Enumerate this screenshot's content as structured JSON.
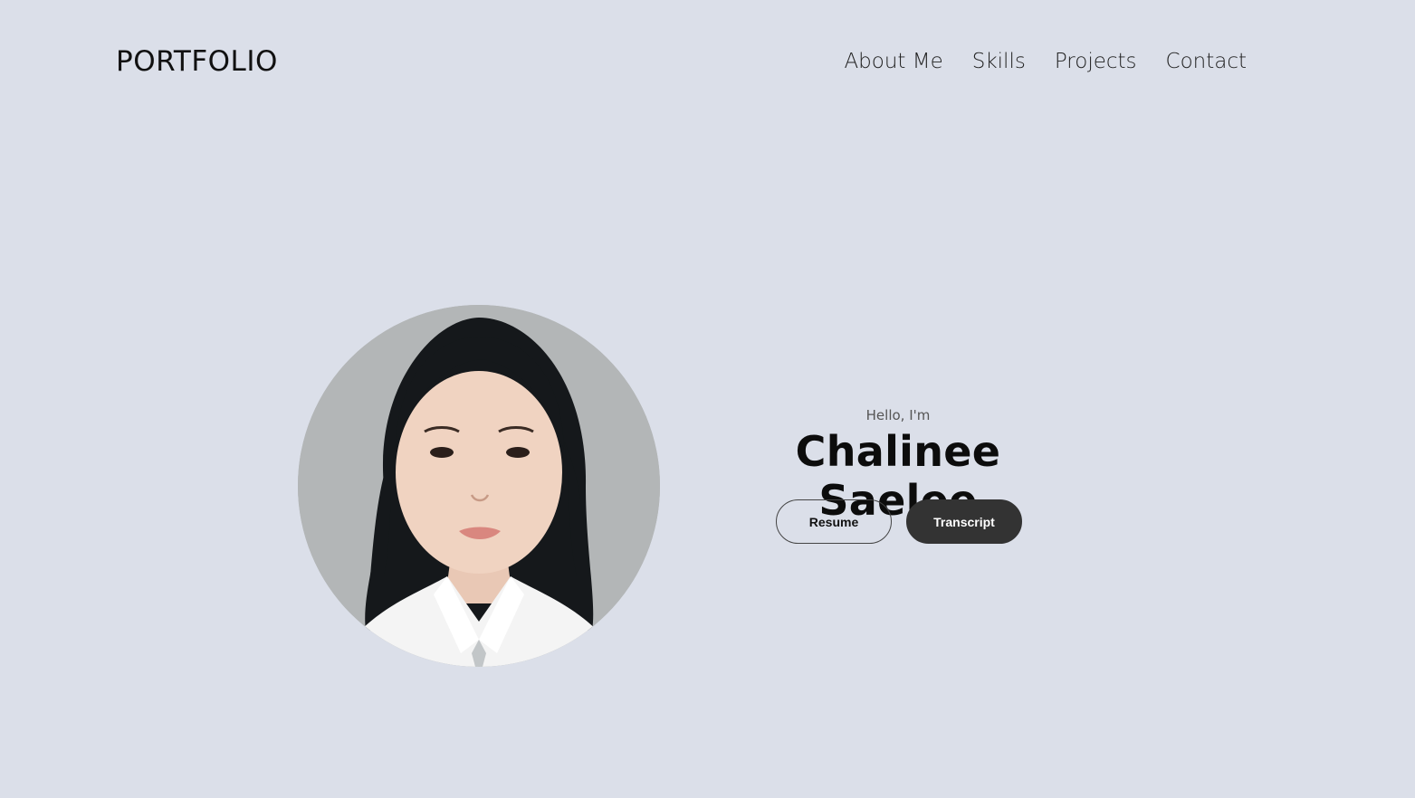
{
  "header": {
    "logo": "PORTFOLIO",
    "nav": [
      {
        "label": "About Me"
      },
      {
        "label": "Skills"
      },
      {
        "label": "Projects"
      },
      {
        "label": "Contact"
      }
    ]
  },
  "hero": {
    "greeting": "Hello, I'm",
    "name": "Chalinee Saelee",
    "buttons": {
      "resume": "Resume",
      "transcript": "Transcript"
    }
  },
  "colors": {
    "background": "#dbdfe9",
    "button_dark": "#333333"
  }
}
